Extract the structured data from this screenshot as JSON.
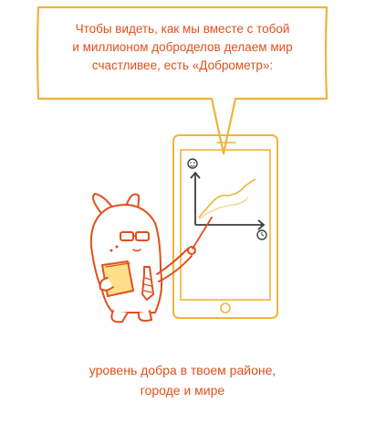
{
  "speech_bubble": {
    "lines": [
      "Чтобы видеть, как мы вместе с тобой",
      "и миллионом доброделов делаем мир",
      "счастливее, есть «Доброметр»:"
    ]
  },
  "caption": {
    "lines": [
      "уровень добра в твоем районе,",
      "городе и мире"
    ]
  },
  "colors": {
    "bubble_stroke": "#f0b33c",
    "text": "#e0501c",
    "mascot_stroke": "#e0501c",
    "phone_stroke": "#f0b33c",
    "chart_axis": "#3d3d3d",
    "chart_line": "#f0b33c"
  },
  "icons": [
    "smiley-icon",
    "clock-icon"
  ]
}
